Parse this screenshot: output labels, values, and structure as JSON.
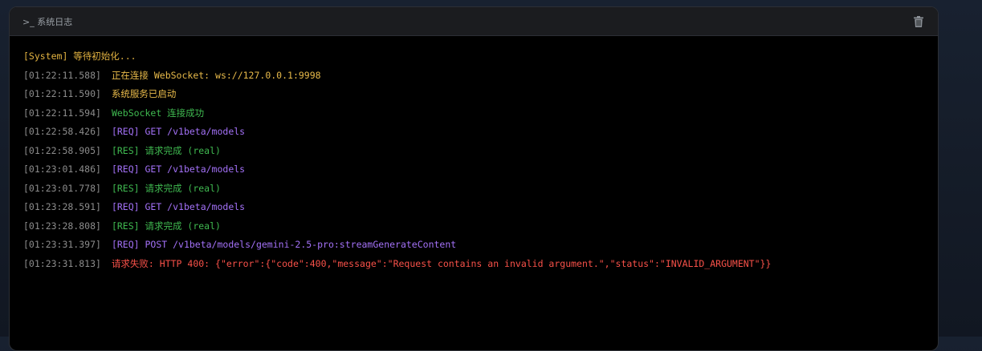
{
  "panel": {
    "title": ">_ 系统日志",
    "clear_icon": "trash-icon"
  },
  "colors": {
    "system": "#e3b341",
    "info": "#e8ba4a",
    "success": "#3fb950",
    "request": "#a371f7",
    "response": "#3fb950",
    "error": "#f85149",
    "timestamp": "#8c8c8c"
  },
  "log": {
    "init_line": "[System] 等待初始化...",
    "entries": [
      {
        "ts": "[01:22:11.588]",
        "msg": "正在连接 WebSocket: ws://127.0.0.1:9998"
      },
      {
        "ts": "[01:22:11.590]",
        "msg": "系统服务已启动"
      },
      {
        "ts": "[01:22:11.594]",
        "msg": "WebSocket 连接成功"
      },
      {
        "ts": "[01:22:58.426]",
        "msg": "[REQ] GET /v1beta/models"
      },
      {
        "ts": "[01:22:58.905]",
        "msg": "[RES] 请求完成 (real)"
      },
      {
        "ts": "[01:23:01.486]",
        "msg": "[REQ] GET /v1beta/models"
      },
      {
        "ts": "[01:23:01.778]",
        "msg": "[RES] 请求完成 (real)"
      },
      {
        "ts": "[01:23:28.591]",
        "msg": "[REQ] GET /v1beta/models"
      },
      {
        "ts": "[01:23:28.808]",
        "msg": "[RES] 请求完成 (real)"
      },
      {
        "ts": "[01:23:31.397]",
        "msg": "[REQ] POST /v1beta/models/gemini-2.5-pro:streamGenerateContent"
      },
      {
        "ts": "[01:23:31.813]",
        "msg": "请求失败: HTTP 400: {\"error\":{\"code\":400,\"message\":\"Request contains an invalid argument.\",\"status\":\"INVALID_ARGUMENT\"}}"
      }
    ]
  }
}
